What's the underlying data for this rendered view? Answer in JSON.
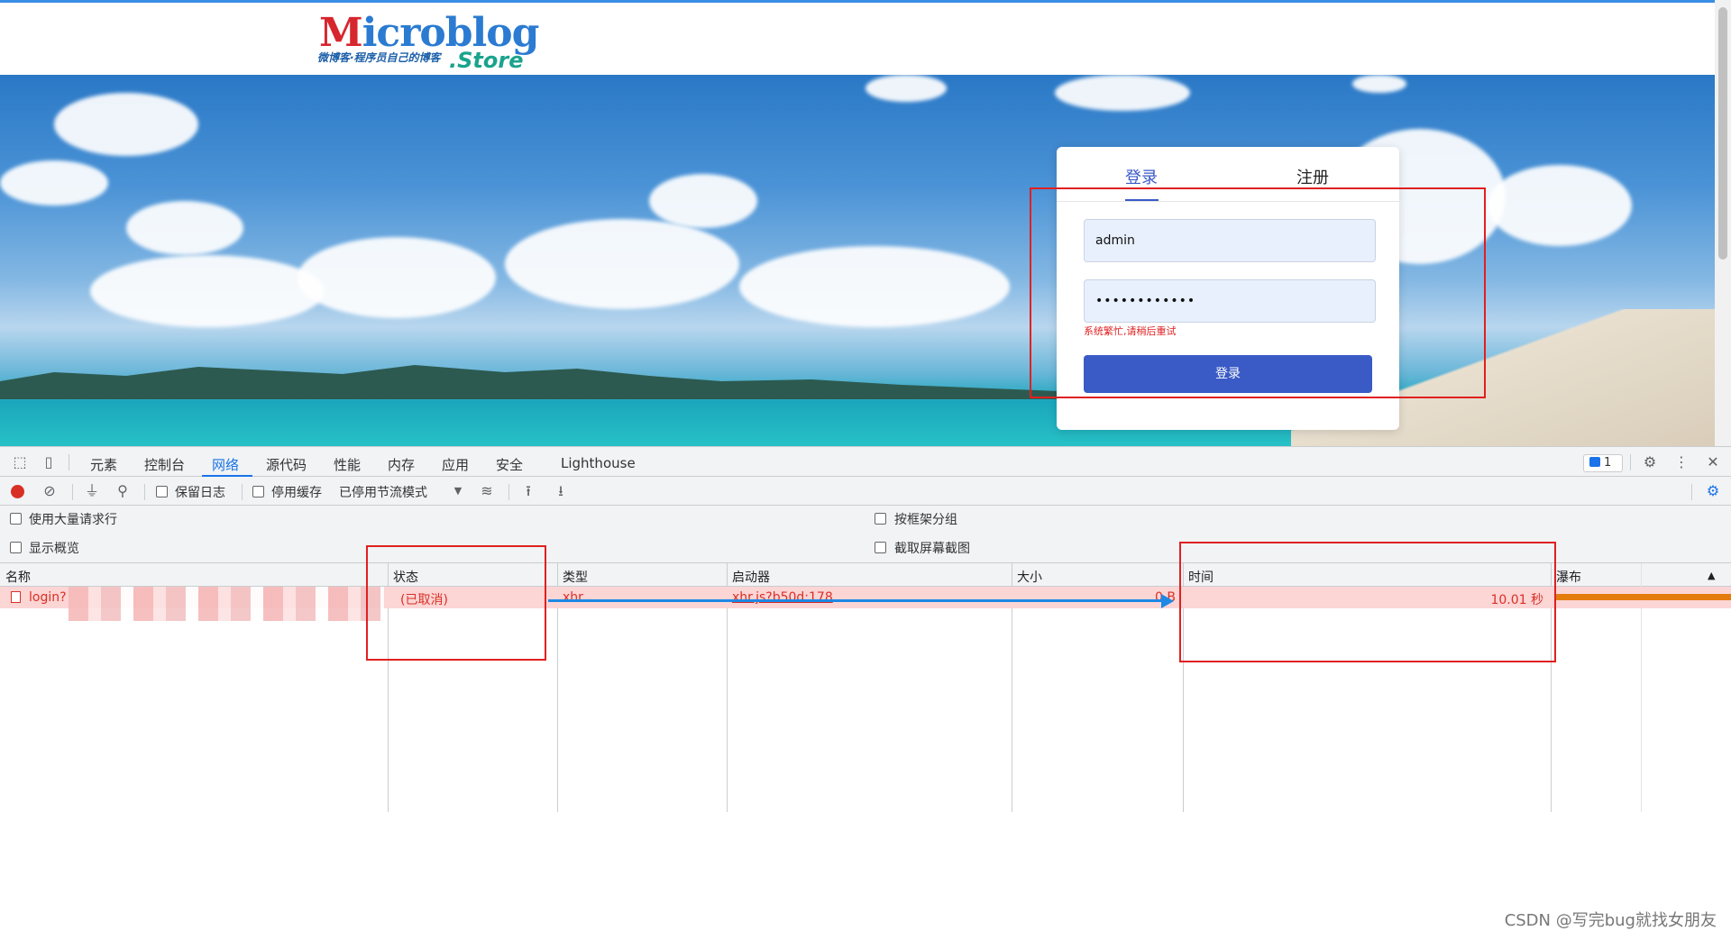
{
  "site": {
    "logo_text_main": "icroblog",
    "logo_text_m": "M",
    "logo_tagline": "微博客·程序员自己的博客",
    "logo_store": ".Store"
  },
  "login_card": {
    "tab_login": "登录",
    "tab_register": "注册",
    "username_value": "admin",
    "password_value": "••••••••••••",
    "error_text": "系统繁忙,请稍后重试",
    "submit_label": "登录"
  },
  "devtools": {
    "tabs": [
      "元素",
      "控制台",
      "网络",
      "源代码",
      "性能",
      "内存",
      "应用",
      "安全",
      "Lighthouse"
    ],
    "active_tab": "网络",
    "issues_count": "1",
    "toolbar": {
      "preserve_log": "保留日志",
      "disable_cache": "停用缓存",
      "throttling": "已停用节流模式"
    },
    "options": {
      "large_rows": "使用大量请求行",
      "overview": "显示概览",
      "group_by_frame": "按框架分组",
      "capture_screenshots": "截取屏幕截图"
    },
    "columns": [
      "名称",
      "状态",
      "类型",
      "启动器",
      "大小",
      "时间",
      "瀑布"
    ],
    "rows": [
      {
        "name": "login?",
        "status": "(已取消)",
        "type": "xhr",
        "initiator": "xhr.js?b50d:178",
        "size": "0 B",
        "time": "10.01 秒"
      }
    ]
  },
  "watermark": "CSDN @写完bug就找女朋友",
  "colors": {
    "accent": "#3a5ac6",
    "devtools_blue": "#1a73e8",
    "error_red": "#e02020",
    "row_error_bg": "#fcd5d5",
    "waterfall_orange": "#e37c0c"
  }
}
